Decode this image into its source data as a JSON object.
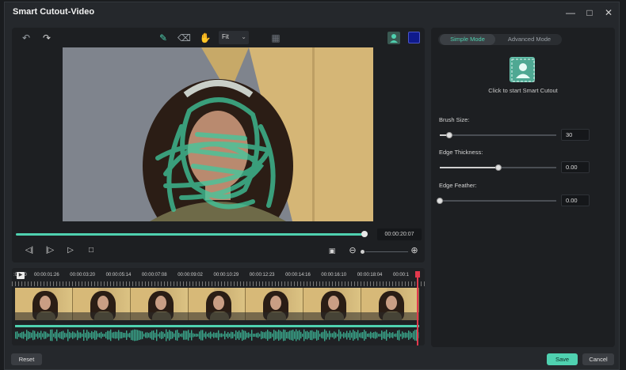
{
  "window": {
    "title": "Smart Cutout-Video",
    "controls": [
      "minimize-icon",
      "maximize-icon",
      "close-icon"
    ]
  },
  "preview": {
    "toolbar": {
      "undo_icon": "undo-icon",
      "redo_icon": "redo-icon",
      "brush_icon": "smart-brush-icon",
      "eraser_icon": "eraser-icon",
      "hand_icon": "hand-icon",
      "fit_select": "Fit",
      "compare_icon": "compare-icon",
      "person_icon": "person-icon",
      "background_color": "#0f1a8c"
    },
    "progress": 0.99,
    "timecode": "00:00:20:07",
    "controls": [
      "prev-frame-icon",
      "next-frame-icon",
      "play-icon",
      "stop-icon",
      "fullscreen-icon",
      "zoom-out-icon",
      "zoom-in-icon"
    ]
  },
  "timeline": {
    "ruler": [
      ":00:00",
      "00:00:01:26",
      "00:00:03:20",
      "00:00:05:14",
      "00:00:07:08",
      "00:00:09:02",
      "00:00:10:29",
      "00:00:12:23",
      "00:00:14:16",
      "00:00:16:10",
      "00:00:18:04",
      "00:00:1"
    ],
    "thumbnail_count": 7,
    "accent_color": "#4fd1b0",
    "playhead_color": "#e2394d"
  },
  "panel": {
    "modes": [
      "Simple Mode",
      "Advanced Mode"
    ],
    "active_mode": "Simple Mode",
    "cutout_hint": "Click to start Smart Cutout",
    "params": [
      {
        "label": "Brush Size:",
        "value": "30",
        "level": 0.08
      },
      {
        "label": "Edge Thickness:",
        "value": "0.00",
        "level": 0.5
      },
      {
        "label": "Edge Feather:",
        "value": "0.00",
        "level": 0.0
      }
    ]
  },
  "footer": {
    "reset": "Reset",
    "save": "Save",
    "cancel": "Cancel"
  }
}
